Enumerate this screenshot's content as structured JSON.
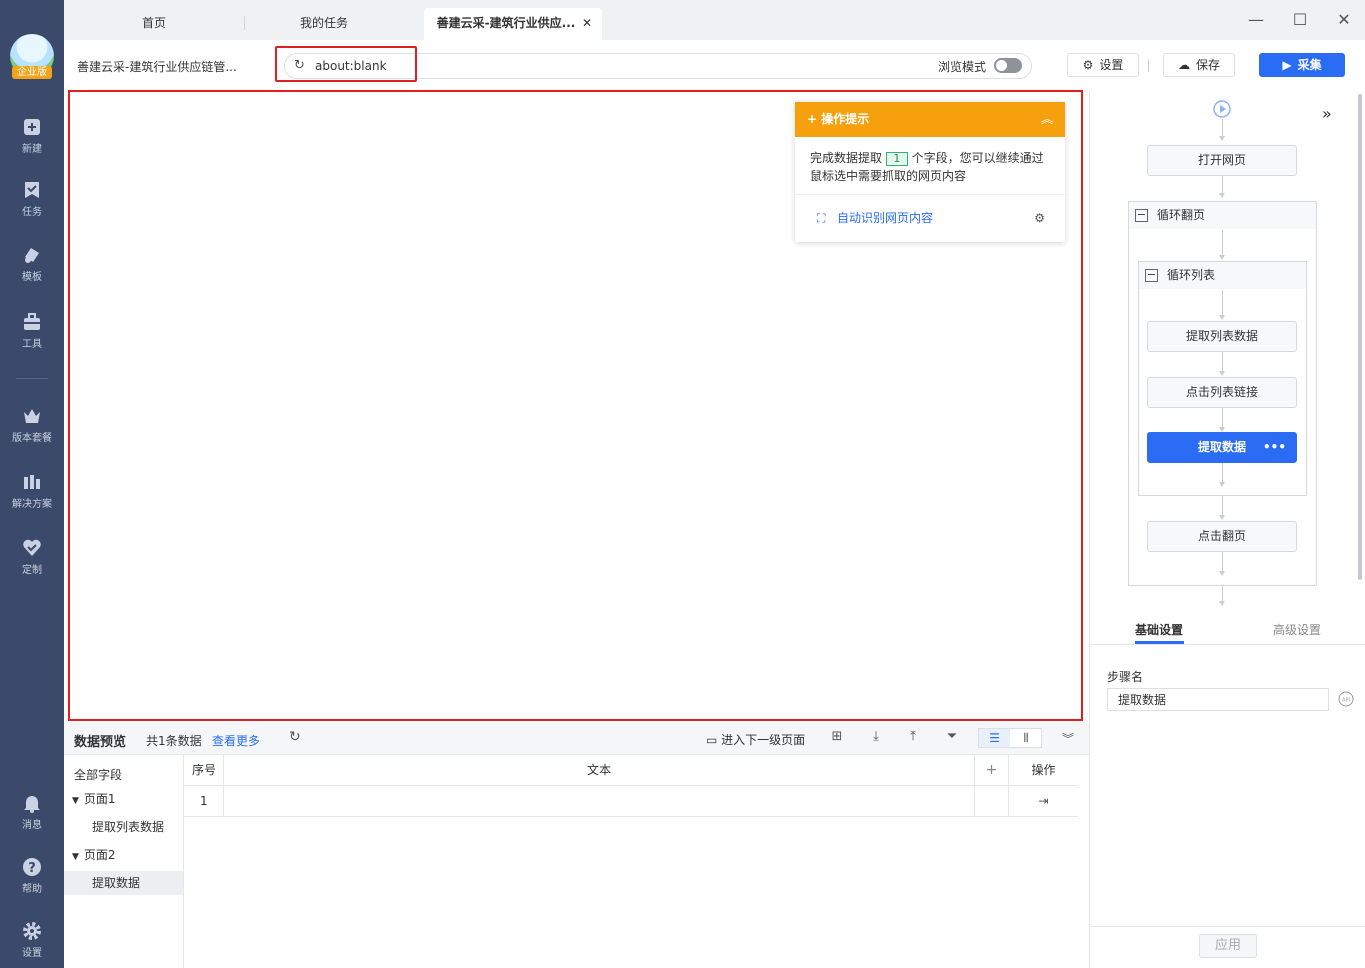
{
  "sidebar": {
    "logo_badge": "企业版",
    "items": [
      {
        "label": "新建",
        "icon": "plus-square-icon"
      },
      {
        "label": "任务",
        "icon": "task-flag-icon"
      },
      {
        "label": "模板",
        "icon": "template-icon"
      },
      {
        "label": "工具",
        "icon": "toolbox-icon"
      },
      {
        "label": "版本套餐",
        "icon": "crown-icon"
      },
      {
        "label": "解决方案",
        "icon": "solution-icon"
      },
      {
        "label": "定制",
        "icon": "heart-check-icon"
      }
    ],
    "bottom_items": [
      {
        "label": "消息",
        "icon": "bell-icon"
      },
      {
        "label": "帮助",
        "icon": "help-icon"
      },
      {
        "label": "设置",
        "icon": "gear-icon"
      }
    ]
  },
  "tabs": [
    {
      "label": "首页"
    },
    {
      "label": "我的任务"
    },
    {
      "label": "善建云采-建筑行业供应...",
      "active": true
    }
  ],
  "toolbar": {
    "site_title": "善建云采-建筑行业供应链管...",
    "url": "about:blank",
    "browse_mode_label": "浏览模式",
    "browse_mode_on": false,
    "settings_label": "设置",
    "save_label": "保存",
    "collect_label": "采集"
  },
  "hint_card": {
    "title": "操作提示",
    "body_prefix": "完成数据提取",
    "field_count": "1",
    "body_suffix": "个字段，您可以继续通过鼠标选中需要抓取的网页内容",
    "auto_detect_label": "自动识别网页内容"
  },
  "preview": {
    "title": "数据预览",
    "count_text": "共1条数据",
    "more_link": "查看更多",
    "next_level_label": "进入下一级页面",
    "tree": {
      "all_fields": "全部字段",
      "page1": "页面1",
      "page1_child": "提取列表数据",
      "page2": "页面2",
      "page2_child": "提取数据"
    },
    "columns": {
      "index": "序号",
      "text": "文本",
      "add": "+",
      "action": "操作"
    },
    "rows": [
      {
        "index": "1",
        "text": ""
      }
    ]
  },
  "workflow": {
    "open_page": "打开网页",
    "loop_page": "循环翻页",
    "loop_list": "循环列表",
    "extract_list": "提取列表数据",
    "click_link": "点击列表链接",
    "extract_data": "提取数据",
    "click_next": "点击翻页"
  },
  "settings": {
    "tab_basic": "基础设置",
    "tab_advanced": "高级设置",
    "step_name_label": "步骤名",
    "step_name_value": "提取数据",
    "apply_label": "应用"
  },
  "colors": {
    "sidebar_bg": "#3b4a6b",
    "primary": "#2a6df4",
    "hint_orange": "#f7a00d",
    "highlight_red": "#e02020"
  }
}
